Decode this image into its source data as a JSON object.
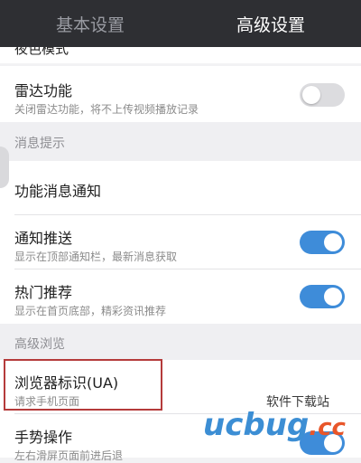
{
  "tabs": {
    "basic": "基本设置",
    "advanced": "高级设置"
  },
  "cut_row_title": "夜色模式",
  "radar": {
    "title": "雷达功能",
    "subtitle": "关闭雷达功能，将不上传视频播放记录",
    "enabled": false
  },
  "section_notify": "消息提示",
  "feature_notice": {
    "title": "功能消息通知"
  },
  "push": {
    "title": "通知推送",
    "subtitle": "显示在顶部通知栏，最新消息获取",
    "enabled": true
  },
  "hot": {
    "title": "热门推荐",
    "subtitle": "显示在首页底部，精彩资讯推荐",
    "enabled": true
  },
  "section_browse": "高级浏览",
  "ua": {
    "title": "浏览器标识(UA)",
    "subtitle": "请求手机页面"
  },
  "gesture": {
    "title": "手势操作",
    "subtitle": "左右滑屏页面前进后退",
    "enabled": true
  },
  "watermark": {
    "top": "软件下载站",
    "brand": "ucbug",
    "suffix": ".cc"
  },
  "colors": {
    "accent": "#3e8cd9",
    "highlight": "#b53b3b",
    "tabbar": "#2e2f33"
  }
}
